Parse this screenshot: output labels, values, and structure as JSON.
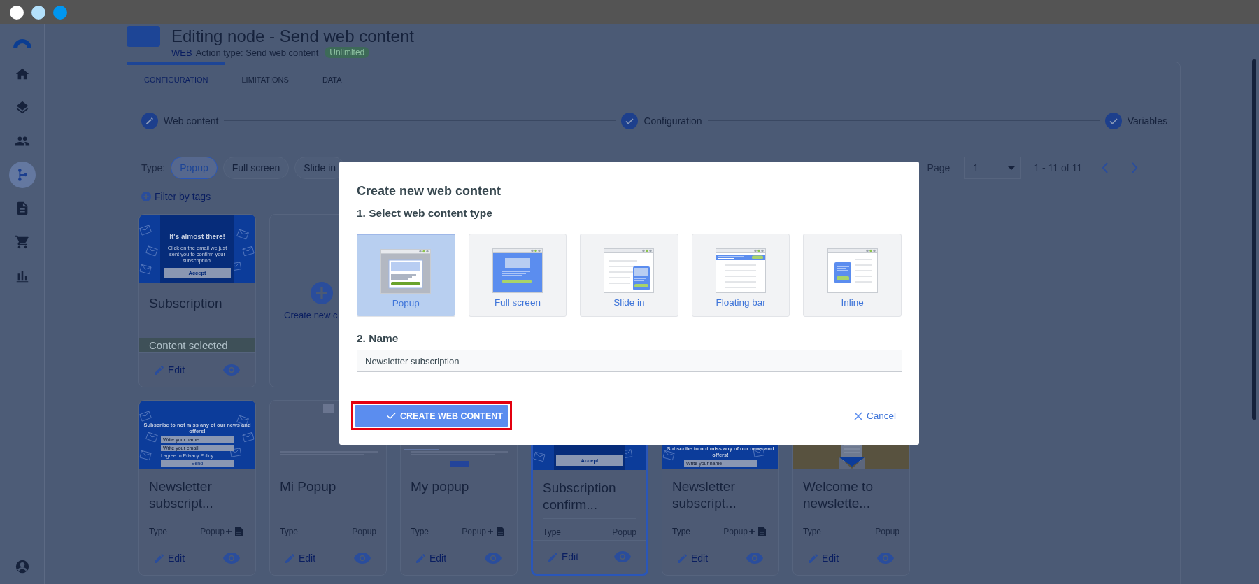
{
  "window_controls": [
    {
      "color": "#ffffff"
    },
    {
      "color": "#b3e0fb"
    },
    {
      "color": "#0096f0"
    }
  ],
  "sidebar": {
    "items": [
      {
        "kind": "home",
        "selected": false
      },
      {
        "kind": "layers",
        "selected": false
      },
      {
        "kind": "people",
        "selected": false
      },
      {
        "kind": "flow",
        "selected": true
      },
      {
        "kind": "document",
        "selected": false
      },
      {
        "kind": "cart",
        "selected": false
      },
      {
        "kind": "chart",
        "selected": false
      }
    ]
  },
  "header": {
    "title": "Editing node - Send web content",
    "channel": "WEB",
    "action_type": "Action type: Send web content",
    "badge": "Unlimited"
  },
  "tabs": [
    {
      "label": "CONFIGURATION",
      "selected": true
    },
    {
      "label": "LIMITATIONS",
      "selected": false
    },
    {
      "label": "DATA",
      "selected": false
    }
  ],
  "stepper": [
    {
      "label": "Web content",
      "kind": "edit"
    },
    {
      "label": "Configuration",
      "kind": "done"
    },
    {
      "label": "Variables",
      "kind": "done"
    }
  ],
  "filters": {
    "type_label": "Type:",
    "types": [
      {
        "label": "Popup",
        "selected": true
      },
      {
        "label": "Full screen",
        "selected": false
      },
      {
        "label": "Slide in",
        "selected": false
      }
    ],
    "filter_by_tags": "Filter by tags"
  },
  "pagination": {
    "label": "Page",
    "value": "1",
    "range": "1 - 11 of 11"
  },
  "top_cards": [
    {
      "kind": "content",
      "name": "Subscription",
      "selected": false,
      "status": "Content selected",
      "edit": "Edit",
      "thumbnail": {
        "kind": "confirm",
        "heading": "It's almost there!",
        "body": "Click on the email we just sent you to confirm your subscription.",
        "button": "Accept"
      }
    },
    {
      "kind": "create",
      "label": "Create new c"
    }
  ],
  "cards": [
    {
      "name": "Newsletter subscript...",
      "selected": false,
      "type_label": "Type",
      "type": "Popup",
      "has_template": true,
      "edit": "Edit",
      "thumbnail": {
        "kind": "form",
        "heading": "Subscribe to not miss any of our news and offers!",
        "fields": [
          "Write your name",
          "Write your email"
        ],
        "checkbox": "I agree to Privacy Policy",
        "button": "Send"
      }
    },
    {
      "name": "Mi Popup",
      "selected": false,
      "type_label": "Type",
      "type": "Popup",
      "has_template": false,
      "edit": "Edit",
      "thumbnail": {
        "kind": "plain"
      }
    },
    {
      "name": "My popup",
      "selected": false,
      "type_label": "Type",
      "type": "Popup",
      "has_template": true,
      "edit": "Edit",
      "thumbnail": {
        "kind": "plain_submit"
      }
    },
    {
      "name": "Subscription confirm...",
      "selected": true,
      "type_label": "Type",
      "type": "Popup",
      "has_template": false,
      "edit": "Edit",
      "thumbnail": {
        "kind": "confirm",
        "button": "Accept"
      }
    },
    {
      "name": "Newsletter subscript...",
      "selected": false,
      "type_label": "Type",
      "type": "Popup",
      "has_template": true,
      "edit": "Edit",
      "thumbnail": {
        "kind": "form",
        "heading": "Subscribe to not miss any of our news and offers!",
        "fields": [
          "Write your name"
        ]
      }
    },
    {
      "name": "Welcome to newslette...",
      "selected": false,
      "type_label": "Type",
      "type": "Popup",
      "has_template": false,
      "edit": "Edit",
      "thumbnail": {
        "kind": "welcome"
      }
    }
  ],
  "modal": {
    "title": "Create new web content",
    "step1": "1. Select web content type",
    "options": [
      {
        "kind": "popup",
        "label": "Popup",
        "selected": true
      },
      {
        "kind": "fullscreen",
        "label": "Full screen",
        "selected": false
      },
      {
        "kind": "slidein",
        "label": "Slide in",
        "selected": false
      },
      {
        "kind": "floatingbar",
        "label": "Floating bar",
        "selected": false
      },
      {
        "kind": "inline",
        "label": "Inline",
        "selected": false
      }
    ],
    "step2": "2. Name",
    "name_value": "Newsletter subscription",
    "create_button": "CREATE WEB CONTENT",
    "create_highlighted": true,
    "cancel": "Cancel"
  }
}
